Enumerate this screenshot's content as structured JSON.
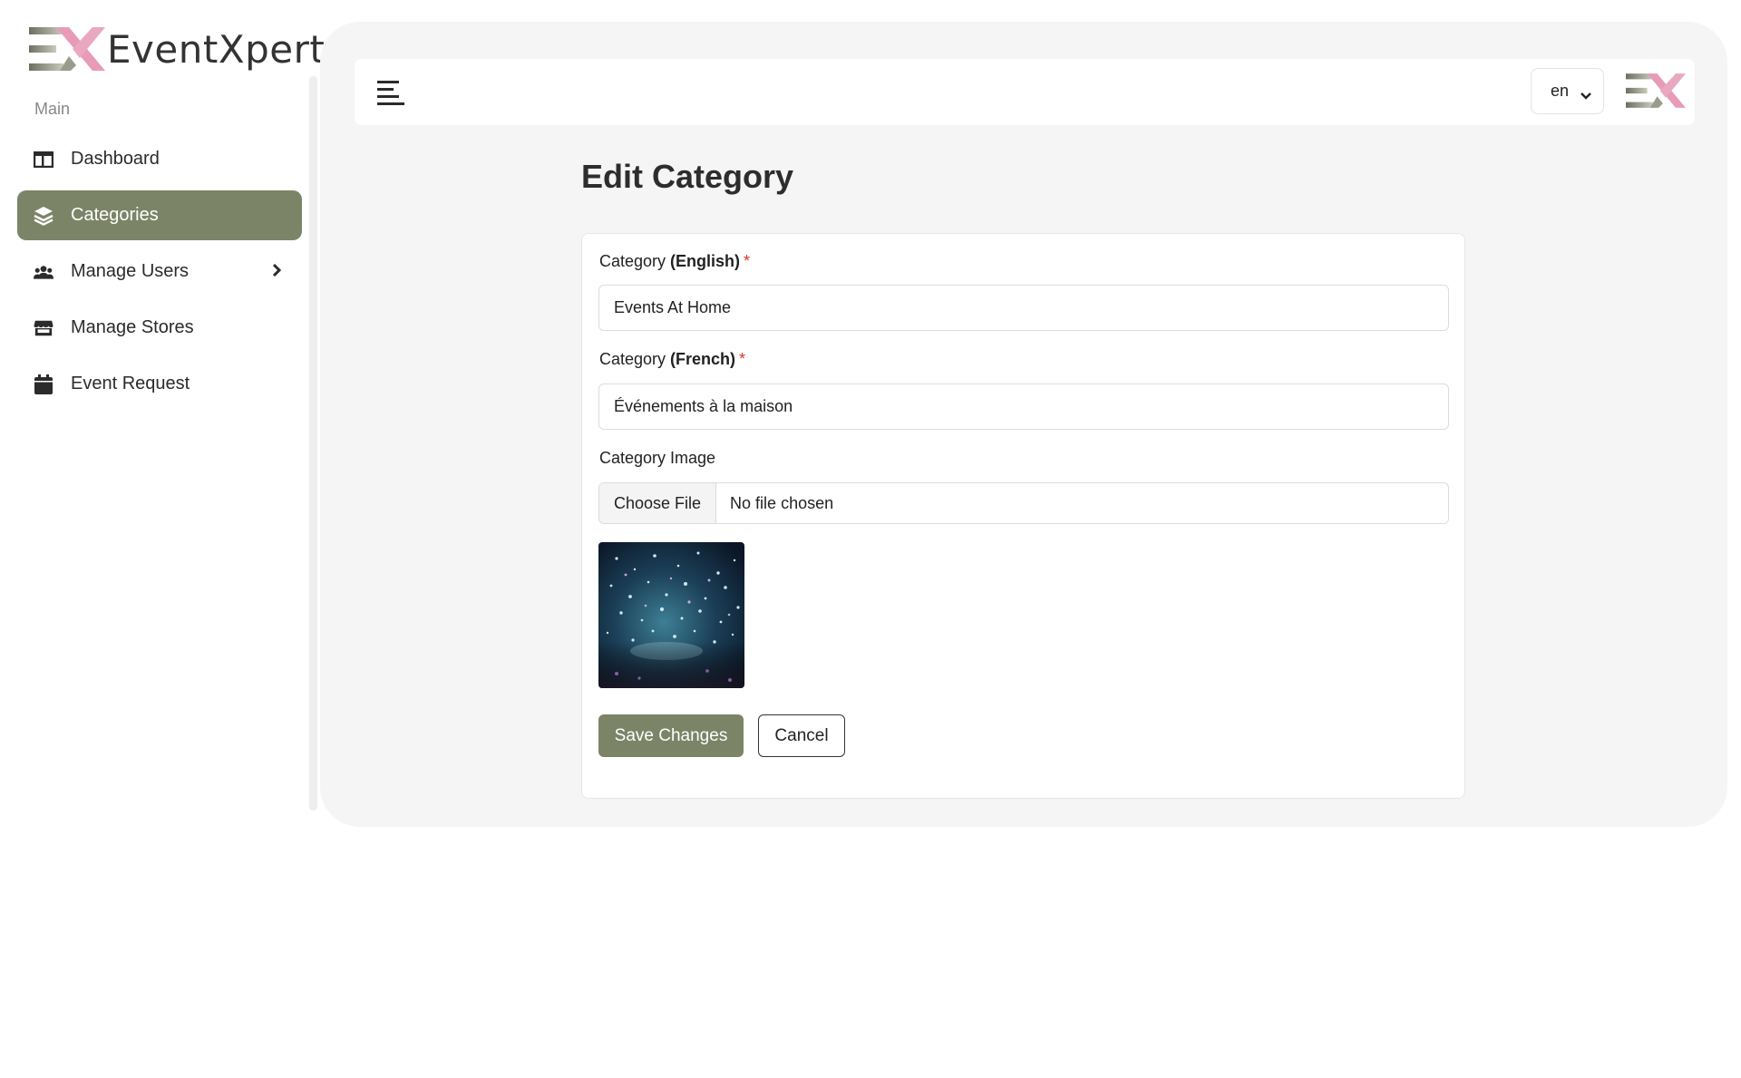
{
  "app": {
    "name": "EventXpert"
  },
  "sidebar": {
    "section_label": "Main",
    "items": [
      {
        "label": "Dashboard",
        "icon": "dashboard-icon",
        "active": false
      },
      {
        "label": "Categories",
        "icon": "layers-icon",
        "active": true
      },
      {
        "label": "Manage Users",
        "icon": "users-icon",
        "active": false,
        "has_submenu": true
      },
      {
        "label": "Manage Stores",
        "icon": "store-icon",
        "active": false
      },
      {
        "label": "Event Request",
        "icon": "calendar-icon",
        "active": false
      }
    ]
  },
  "topbar": {
    "language": "en",
    "menu_icon": "hamburger-icon"
  },
  "page": {
    "title": "Edit Category"
  },
  "form": {
    "english": {
      "label_prefix": "Category ",
      "label_bold": "(English)",
      "required_mark": "*",
      "value": "Events At Home"
    },
    "french": {
      "label_prefix": "Category ",
      "label_bold": "(French)",
      "required_mark": "*",
      "value": "Événements à la maison"
    },
    "image": {
      "label": "Category Image",
      "choose_label": "Choose File",
      "file_status": "No file chosen"
    },
    "save_label": "Save Changes",
    "cancel_label": "Cancel"
  },
  "colors": {
    "accent": "#7c8467",
    "logo_pink": "#e89bb8",
    "logo_gray": "#7f806f",
    "required": "#d9362f"
  }
}
